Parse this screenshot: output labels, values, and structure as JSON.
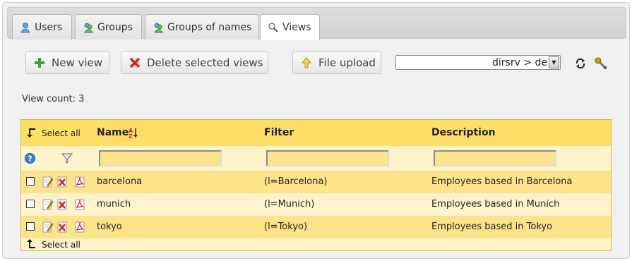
{
  "tabs": [
    {
      "label": "Users",
      "icon": "user-icon"
    },
    {
      "label": "Groups",
      "icon": "group-icon"
    },
    {
      "label": "Groups of names",
      "icon": "group-icon"
    },
    {
      "label": "Views",
      "icon": "magnifier-icon",
      "active": true
    }
  ],
  "toolbar": {
    "new_view": "New view",
    "delete_views": "Delete selected views",
    "file_upload": "File upload",
    "server_select_value": "dirsrv > de"
  },
  "view_count_text": "View count: 3",
  "table": {
    "select_all": "Select all",
    "columns": [
      "Name",
      "Filter",
      "Description"
    ],
    "filter_placeholders": [
      "",
      "",
      ""
    ],
    "rows": [
      {
        "name": "barcelona",
        "filter": "(l=Barcelona)",
        "description": "Employees based in Barcelona"
      },
      {
        "name": "munich",
        "filter": "(l=Munich)",
        "description": "Employees based in Munich"
      },
      {
        "name": "tokyo",
        "filter": "(l=Tokyo)",
        "description": "Employees based in Tokyo"
      }
    ]
  },
  "colors": {
    "header": "#fddf68",
    "row_alt": "#fde48a",
    "row": "#fff3cd",
    "accent_green": "#3aa33a",
    "accent_red": "#d42020"
  }
}
